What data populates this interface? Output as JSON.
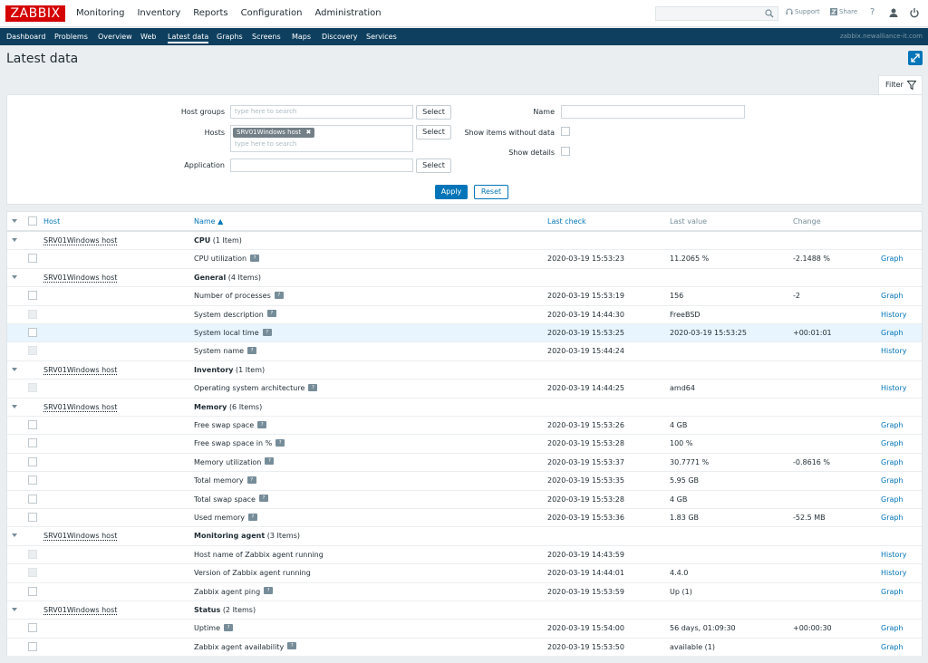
{
  "header": {
    "logo": "ZABBIX",
    "main_menu": [
      "Monitoring",
      "Inventory",
      "Reports",
      "Configuration",
      "Administration"
    ],
    "search_placeholder": "",
    "support": "Support",
    "share": "Share",
    "help": "?"
  },
  "subnav": {
    "items": [
      "Dashboard",
      "Problems",
      "Overview",
      "Web",
      "Latest data",
      "Graphs",
      "Screens",
      "Maps",
      "Discovery",
      "Services"
    ],
    "active": "Latest data",
    "server": "zabbix.newalliance-it.com"
  },
  "page_title": "Latest data",
  "filter": {
    "tab_label": "Filter",
    "host_groups_label": "Host groups",
    "hosts_label": "Hosts",
    "application_label": "Application",
    "name_label": "Name",
    "show_items_label": "Show items without data",
    "show_details_label": "Show details",
    "placeholder": "type here to search",
    "selected_host": "SRV01Windows host",
    "select_label": "Select",
    "apply_label": "Apply",
    "reset_label": "Reset"
  },
  "table": {
    "headers": {
      "host": "Host",
      "name": "Name ▲",
      "last_check": "Last check",
      "last_value": "Last value",
      "change": "Change"
    },
    "rows": [
      {
        "type": "group",
        "host": "SRV01Windows host",
        "app": "CPU",
        "count": "(1 Item)"
      },
      {
        "type": "item",
        "name": "CPU utilization",
        "hint": true,
        "last_check": "2020-03-19 15:53:23",
        "last_value": "11.2065 %",
        "change": "-2.1488 %",
        "action": "Graph",
        "cb_disabled": false
      },
      {
        "type": "group",
        "host": "SRV01Windows host",
        "app": "General",
        "count": "(4 Items)"
      },
      {
        "type": "item",
        "name": "Number of processes",
        "hint": true,
        "last_check": "2020-03-19 15:53:19",
        "last_value": "156",
        "change": "-2",
        "action": "Graph",
        "cb_disabled": false
      },
      {
        "type": "item",
        "name": "System description",
        "hint": true,
        "last_check": "2020-03-19 14:44:30",
        "last_value": "FreeBSD",
        "change": "",
        "action": "History",
        "cb_disabled": true
      },
      {
        "type": "item",
        "name": "System local time",
        "hint": true,
        "last_check": "2020-03-19 15:53:25",
        "last_value": "2020-03-19 15:53:25",
        "change": "+00:01:01",
        "action": "Graph",
        "cb_disabled": false,
        "highlight": true
      },
      {
        "type": "item",
        "name": "System name",
        "hint": true,
        "last_check": "2020-03-19 15:44:24",
        "last_value": "",
        "change": "",
        "action": "History",
        "cb_disabled": true
      },
      {
        "type": "group",
        "host": "SRV01Windows host",
        "app": "Inventory",
        "count": "(1 Item)"
      },
      {
        "type": "item",
        "name": "Operating system architecture",
        "hint": true,
        "last_check": "2020-03-19 14:44:25",
        "last_value": "amd64",
        "change": "",
        "action": "History",
        "cb_disabled": true
      },
      {
        "type": "group",
        "host": "SRV01Windows host",
        "app": "Memory",
        "count": "(6 Items)"
      },
      {
        "type": "item",
        "name": "Free swap space",
        "hint": true,
        "last_check": "2020-03-19 15:53:26",
        "last_value": "4 GB",
        "change": "",
        "action": "Graph",
        "cb_disabled": false
      },
      {
        "type": "item",
        "name": "Free swap space in %",
        "hint": true,
        "last_check": "2020-03-19 15:53:28",
        "last_value": "100 %",
        "change": "",
        "action": "Graph",
        "cb_disabled": false
      },
      {
        "type": "item",
        "name": "Memory utilization",
        "hint": true,
        "last_check": "2020-03-19 15:53:37",
        "last_value": "30.7771 %",
        "change": "-0.8616 %",
        "action": "Graph",
        "cb_disabled": false
      },
      {
        "type": "item",
        "name": "Total memory",
        "hint": true,
        "last_check": "2020-03-19 15:53:35",
        "last_value": "5.95 GB",
        "change": "",
        "action": "Graph",
        "cb_disabled": false
      },
      {
        "type": "item",
        "name": "Total swap space",
        "hint": true,
        "last_check": "2020-03-19 15:53:28",
        "last_value": "4 GB",
        "change": "",
        "action": "Graph",
        "cb_disabled": false
      },
      {
        "type": "item",
        "name": "Used memory",
        "hint": true,
        "last_check": "2020-03-19 15:53:36",
        "last_value": "1.83 GB",
        "change": "-52.5 MB",
        "action": "Graph",
        "cb_disabled": false
      },
      {
        "type": "group",
        "host": "SRV01Windows host",
        "app": "Monitoring agent",
        "count": "(3 Items)"
      },
      {
        "type": "item",
        "name": "Host name of Zabbix agent running",
        "hint": false,
        "last_check": "2020-03-19 14:43:59",
        "last_value": "",
        "change": "",
        "action": "History",
        "cb_disabled": true
      },
      {
        "type": "item",
        "name": "Version of Zabbix agent running",
        "hint": false,
        "last_check": "2020-03-19 14:44:01",
        "last_value": "4.4.0",
        "change": "",
        "action": "History",
        "cb_disabled": true
      },
      {
        "type": "item",
        "name": "Zabbix agent ping",
        "hint": true,
        "last_check": "2020-03-19 15:53:59",
        "last_value": "Up (1)",
        "change": "",
        "action": "Graph",
        "cb_disabled": false
      },
      {
        "type": "group",
        "host": "SRV01Windows host",
        "app": "Status",
        "count": "(2 Items)"
      },
      {
        "type": "item",
        "name": "Uptime",
        "hint": true,
        "last_check": "2020-03-19 15:54:00",
        "last_value": "56 days, 01:09:30",
        "change": "+00:00:30",
        "action": "Graph",
        "cb_disabled": false
      },
      {
        "type": "item",
        "name": "Zabbix agent availability",
        "hint": true,
        "last_check": "2020-03-19 15:53:50",
        "last_value": "available (1)",
        "change": "",
        "action": "Graph",
        "cb_disabled": false
      }
    ]
  }
}
